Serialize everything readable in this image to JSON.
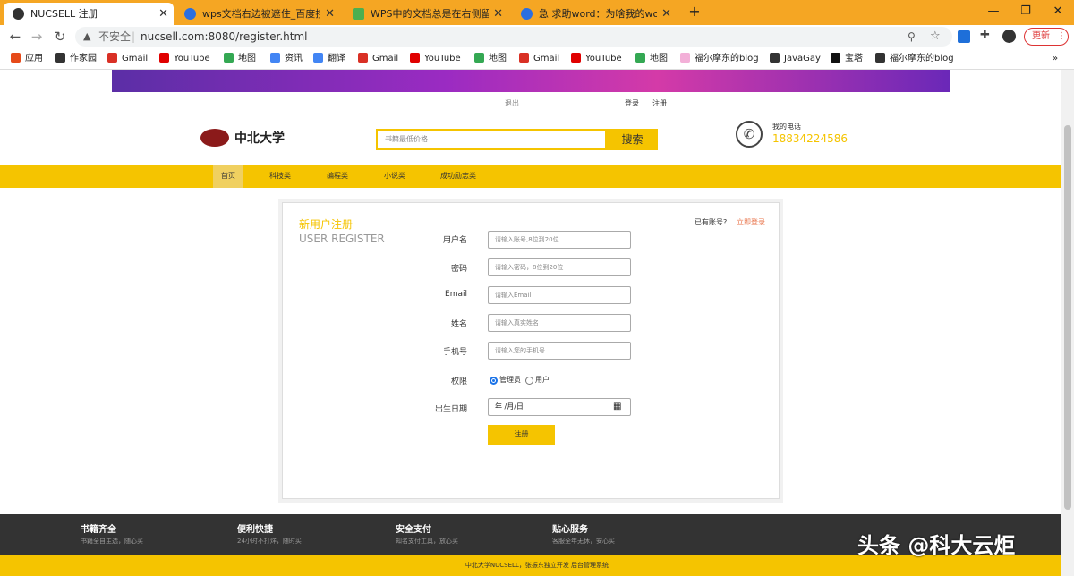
{
  "browser": {
    "tabs": [
      {
        "title": "NUCSELL 注册",
        "favicon_color": "#333333"
      },
      {
        "title": "wps文档右边被遮住_百度搜索",
        "favicon_color": "#2b6fe0"
      },
      {
        "title": "WPS中的文档总是在右侧留下空白",
        "favicon_color": "#4caf50"
      },
      {
        "title": "急 求助word：为啥我的word打",
        "favicon_color": "#2b6fe0"
      }
    ],
    "new_tab": "+",
    "window_controls": {
      "minimize": "—",
      "restore": "❐",
      "close": "✕"
    },
    "back": "←",
    "forward": "→",
    "reload": "↻",
    "security": "不安全",
    "url": "nucsell.com:8080/register.html",
    "update_button": "更新",
    "bookmarks": [
      {
        "label": "应用",
        "color": "#e64a19"
      },
      {
        "label": "作家园",
        "color": "#333333"
      },
      {
        "label": "Gmail",
        "color": "#d93025"
      },
      {
        "label": "YouTube",
        "color": "#e00000"
      },
      {
        "label": "地图",
        "color": "#34a853"
      },
      {
        "label": "资讯",
        "color": "#4285f4"
      },
      {
        "label": "翻译",
        "color": "#4285f4"
      },
      {
        "label": "Gmail",
        "color": "#d93025"
      },
      {
        "label": "YouTube",
        "color": "#e00000"
      },
      {
        "label": "地图",
        "color": "#34a853"
      },
      {
        "label": "Gmail",
        "color": "#d93025"
      },
      {
        "label": "YouTube",
        "color": "#e00000"
      },
      {
        "label": "地图",
        "color": "#34a853"
      },
      {
        "label": "福尔摩东的blog",
        "color": "#f3b0d8"
      },
      {
        "label": "JavaGay",
        "color": "#333333"
      },
      {
        "label": "宝塔",
        "color": "#111111"
      },
      {
        "label": "福尔摩东的blog",
        "color": "#333333"
      }
    ]
  },
  "site": {
    "logout": "退出",
    "login": "登录",
    "register": "注册",
    "logo_text": "中北大学",
    "search_placeholder": "书籍最低价格",
    "search_button": "搜索",
    "phone_label": "我的电话",
    "phone_number": "18834224586",
    "nav": [
      "首页",
      "科技类",
      "编程类",
      "小说类",
      "成功励志类"
    ],
    "accent_color": "#f5c400"
  },
  "form": {
    "title_cn": "新用户注册",
    "title_en": "USER REGISTER",
    "have_account": "已有账号?",
    "login_now": "立即登录",
    "fields": [
      {
        "label": "用户名",
        "placeholder": "请输入账号,8位到20位"
      },
      {
        "label": "密码",
        "placeholder": "请输入密码，8位到20位"
      },
      {
        "label": "Email",
        "placeholder": "请输入Email"
      },
      {
        "label": "姓名",
        "placeholder": "请输入真实姓名"
      },
      {
        "label": "手机号",
        "placeholder": "请输入您的手机号"
      }
    ],
    "role_label": "权限",
    "role_admin": "管理员",
    "role_user": "用户",
    "birthday_label": "出生日期",
    "birthday_value": "年 /月/日",
    "submit": "注册"
  },
  "footer": {
    "columns": [
      {
        "title": "书籍齐全",
        "sub": "书籍全自主选，随心买"
      },
      {
        "title": "便利快捷",
        "sub": "24小时不打烊，随时买"
      },
      {
        "title": "安全支付",
        "sub": "知名支付工具，放心买"
      },
      {
        "title": "贴心服务",
        "sub": "客服全年无休，安心买"
      }
    ],
    "copyright": "中北大学NUCSELL，张振东独立开发 后台管理系统",
    "watermark": "头条 @科大云炬"
  }
}
